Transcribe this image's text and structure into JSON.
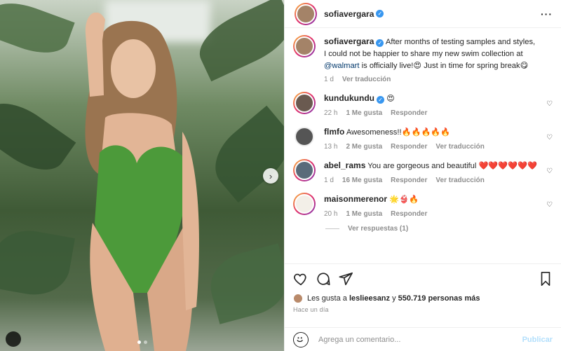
{
  "post": {
    "username": "sofiavergara",
    "caption": "After months of testing samples and styles, I could not be happier to share my new swim collection at",
    "caption_mention": "@walmart",
    "caption_tail": "is officially live!😍 Just in time for spring break😋",
    "caption_age": "1 d",
    "see_translation": "Ver traducción"
  },
  "comments": [
    {
      "username": "kundukundu",
      "verified": true,
      "text": "😍",
      "age": "22 h",
      "likes": "1 Me gusta",
      "reply": "Responder",
      "translation": ""
    },
    {
      "username": "flmfo",
      "verified": false,
      "text": "Awesomeness!!🔥🔥🔥🔥🔥",
      "age": "13 h",
      "likes": "2 Me gusta",
      "reply": "Responder",
      "translation": "Ver traducción"
    },
    {
      "username": "abel_rams",
      "verified": false,
      "text": "You are gorgeous and beautiful ❤️❤️❤️❤️❤️❤️",
      "age": "1 d",
      "likes": "16 Me gusta",
      "reply": "Responder",
      "translation": "Ver traducción"
    },
    {
      "username": "maisonmerenor",
      "verified": false,
      "text": "🌟👙🔥",
      "age": "20 h",
      "likes": "1 Me gusta",
      "reply": "Responder",
      "translation": ""
    }
  ],
  "view_replies": "Ver respuestas (1)",
  "likes_summary": {
    "prefix": "Les gusta a",
    "user": "leslieesanz",
    "joiner": "y",
    "count": "550.719 personas más"
  },
  "post_time": "Hace un día",
  "comment_input": {
    "placeholder": "Agrega un comentario...",
    "post_label": "Publicar"
  },
  "icons": {
    "more": "more-horizontal-icon",
    "like": "heart-icon",
    "comment": "comment-icon",
    "share": "paper-plane-icon",
    "save": "bookmark-icon",
    "next": "chevron-right-icon",
    "emoji": "smiley-icon"
  },
  "colors": {
    "link": "#00376b",
    "verified": "#3897f0",
    "post_button": "#b2dffc",
    "muted": "#8e8e8e"
  }
}
